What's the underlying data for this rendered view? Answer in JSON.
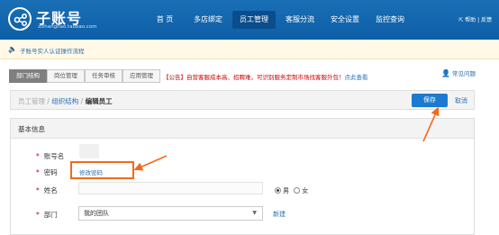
{
  "header": {
    "logo_title": "子账号",
    "logo_sub": "zizhanghao.taobao.com",
    "nav": [
      {
        "label": "首 页",
        "active": false
      },
      {
        "label": "多店绑定",
        "active": false
      },
      {
        "label": "员工管理",
        "active": true
      },
      {
        "label": "客服分流",
        "active": false
      },
      {
        "label": "安全设置",
        "active": false
      },
      {
        "label": "监控查询",
        "active": false
      }
    ],
    "links": "帮助 | 反馈"
  },
  "notice": {
    "text": "子账号实人认证操作流程"
  },
  "tabs": [
    {
      "label": "部门结构",
      "active": true
    },
    {
      "label": "岗位管理",
      "active": false
    },
    {
      "label": "任务审核",
      "active": false
    },
    {
      "label": "应用管理",
      "active": false
    }
  ],
  "announcement": {
    "text": "【公告】自营客服成本高、招聘难，可识别服务定制市场找客服外包！",
    "link": "点此查看"
  },
  "help": "常见问题",
  "breadcrumb": {
    "level1": "员工管理",
    "sep": " / ",
    "level2": "组织结构",
    "level3": "编辑员工"
  },
  "actions": {
    "save": "保存",
    "cancel": "取消"
  },
  "form": {
    "section_title": "基本信息",
    "account_label": "账号名",
    "password_label": "密码",
    "password_link": "修改密码",
    "name_label": "姓名",
    "gender_male": "男",
    "gender_female": "女",
    "dept_label": "部门",
    "dept_value": "我的团队",
    "new_link": "新建",
    "required_mark": "*"
  },
  "colors": {
    "header": "#1a6fb5",
    "primary": "#1c7bd0",
    "annotation": "#f26a1b",
    "link": "#2a6fb0"
  }
}
